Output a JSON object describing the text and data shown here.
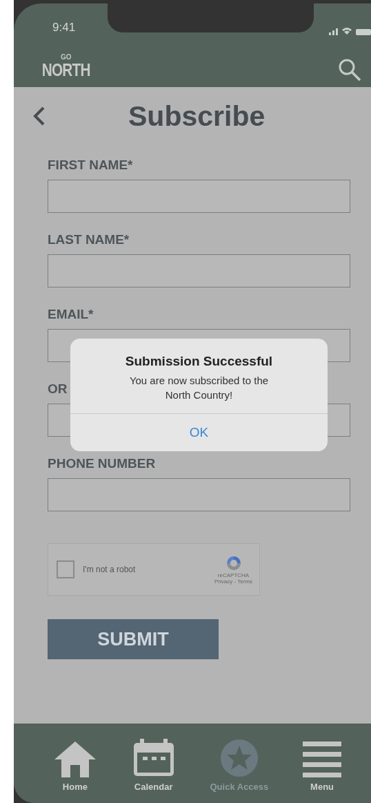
{
  "status_bar": {
    "time": "9:41"
  },
  "header": {
    "logo": {
      "small": "GO",
      "word": "NORTH"
    }
  },
  "page": {
    "title": "Subscribe"
  },
  "fields": [
    {
      "label": "FIRST NAME*"
    },
    {
      "label": "LAST NAME*"
    },
    {
      "label": "EMAIL*"
    },
    {
      "label": "OR"
    },
    {
      "label": "PHONE NUMBER"
    }
  ],
  "captcha": {
    "label": "I'm not a robot",
    "checked": false,
    "brand": "reCAPTCHA",
    "links": "Privacy - Terms"
  },
  "submit": {
    "label": "SUBMIT"
  },
  "dialog": {
    "title": "Submission Successful",
    "message": "You are now subscribed to the North Country!",
    "button": "OK"
  },
  "tab_bar": [
    {
      "kind": "home",
      "label": "Home",
      "disabled": false
    },
    {
      "kind": "calendar",
      "label": "Calendar",
      "disabled": false
    },
    {
      "kind": "star",
      "label": "Quick Access",
      "disabled": true
    },
    {
      "kind": "menu",
      "label": "Menu",
      "disabled": false
    }
  ]
}
